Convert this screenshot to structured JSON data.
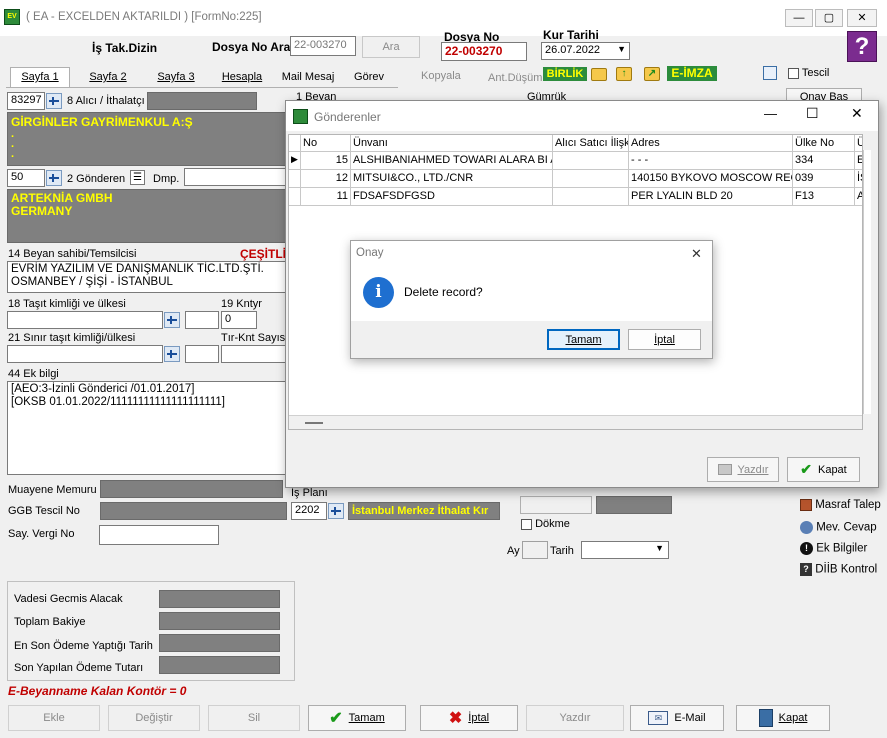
{
  "window": {
    "title": "( EA  - EXCELDEN AKTARILDI ) [FormNo:225]",
    "min": "—",
    "max": "▢",
    "close": "✕"
  },
  "header": {
    "is_takip_label": "İş Tak.Dizin",
    "dosya_no_ara_label": "Dosya No Ara",
    "dosya_no_ara_value": "22-003270",
    "ara_button": "Ara",
    "dosya_no_label": "Dosya No",
    "dosya_no_value": "22-003270",
    "kur_tarihi_label": "Kur Tarihi",
    "kur_tarihi_value": "26.07.2022"
  },
  "tabs": [
    {
      "label": "Sayfa 1"
    },
    {
      "label": "Sayfa 2"
    },
    {
      "label": "Sayfa 3"
    },
    {
      "label": "Hesapla"
    },
    {
      "label": "Mail Mesaj"
    },
    {
      "label": "Görev"
    },
    {
      "label": "Kopyala"
    },
    {
      "label": "Ant.Düşüm"
    }
  ],
  "toolbar": {
    "birlik": "BİRLİK",
    "eimza": "E-İMZA",
    "tescil": "Tescil",
    "onay_bas": "Onay Bas"
  },
  "form": {
    "alici_code": "83297",
    "alici_label": "8 Alıcı / İthalatçı",
    "alici_text": "GİRGİNLER GAYRİMENKUL A:Ş",
    "alici_dots": ".\n.\n.",
    "gonderen_code": "50",
    "gonderen_label": "2 Gönderen",
    "dmp_label": "Dmp.",
    "gonderen_text": "ARTEKNİA GMBH\nGERMANY",
    "beyan_sahibi_label": "14 Beyan sahibi/Temsilcisi",
    "cesitli": "ÇEŞİTLİ",
    "beyan_sahibi_text": "EVRİM YAZILIM VE DANIŞMANLIK TİC.LTD.ŞTİ.\nOSMANBEY / ŞİŞİ - İSTANBUL",
    "tasit_label": "18 Taşıt kimliği ve ülkesi",
    "kntyr_label": "19 Kntyr",
    "kntyr_value": "0",
    "sinir_label": "21 Sınır taşıt kimliği/ülkesi",
    "tir_label": "Tır-Knt Sayısı",
    "ek_bilgi_label": "44 Ek bilgi",
    "ek_bilgi_text": "[AEO:3-İzinli Gönderici /01.01.2017]\n[OKSB 01.01.2022/11111111111111111111]",
    "beyan_hdr": "1 Beyan",
    "gumruk_hdr": "Gümrük",
    "muayene_label": "Muayene Memuru",
    "is_plani_label": "İş Planı",
    "ggb_label": "GGB Tescil No",
    "ggb_code": "2202",
    "ggb_name": "İstanbul Merkez İthalat Kır",
    "dokme_label": "Dökme",
    "say_vergi_label": "Say. Vergi No",
    "ay_label": "Ay",
    "tarih_label": "Tarih",
    "vadesi_label": "Vadesi Gecmis Alacak",
    "toplam_label": "Toplam Bakiye",
    "en_son_label": "En Son Ödeme Yaptığı Tarih",
    "son_tutar_label": "Son Yapılan Ödeme Tutarı",
    "kontor": "E-Beyanname Kalan Kontör = 0"
  },
  "side": {
    "masraf": "Masraf Talep",
    "mev_cevap": "Mev. Cevap",
    "ek_bilgiler": "Ek Bilgiler",
    "diib": "DİİB Kontrol"
  },
  "bottom": {
    "ekle": "Ekle",
    "degistir": "Değiştir",
    "sil": "Sil",
    "tamam": "Tamam",
    "iptal": "İptal",
    "yazdir": "Yazdır",
    "email": "E-Mail",
    "kapat": "Kapat"
  },
  "dialog": {
    "title": "Gönderenler",
    "columns": [
      "No",
      "Ünvanı",
      "Alıcı Satıcı İlişkisi",
      "Adres",
      "Ülke No",
      "Ü"
    ],
    "rows": [
      {
        "marker": "▶",
        "no": "15",
        "unvan": "ALSHIBANIAHMED TOWARI ALARA BI A",
        "iliski": "",
        "adres": "- - -",
        "ulke": "334",
        "u": "E"
      },
      {
        "marker": "",
        "no": "12",
        "unvan": "MITSUI&CO., LTD./CNR",
        "iliski": "",
        "adres": "140150 BYKOVO MOSCOW REG",
        "ulke": "039",
        "u": "İS"
      },
      {
        "marker": "",
        "no": "11",
        "unvan": "FDSAFSDFGSD",
        "iliski": "",
        "adres": "PER LYALIN BLD 20",
        "ulke": "F13",
        "u": "A"
      }
    ],
    "yazdir": "Yazdır",
    "kapat": "Kapat"
  },
  "confirm": {
    "title": "Onay",
    "message": "Delete record?",
    "ok": "Tamam",
    "cancel": "İptal"
  },
  "colors": {
    "gray_panel": "#808080",
    "yellow_text": "#ffff00",
    "red_text": "#c00000",
    "accent_blue": "#0067c0"
  }
}
